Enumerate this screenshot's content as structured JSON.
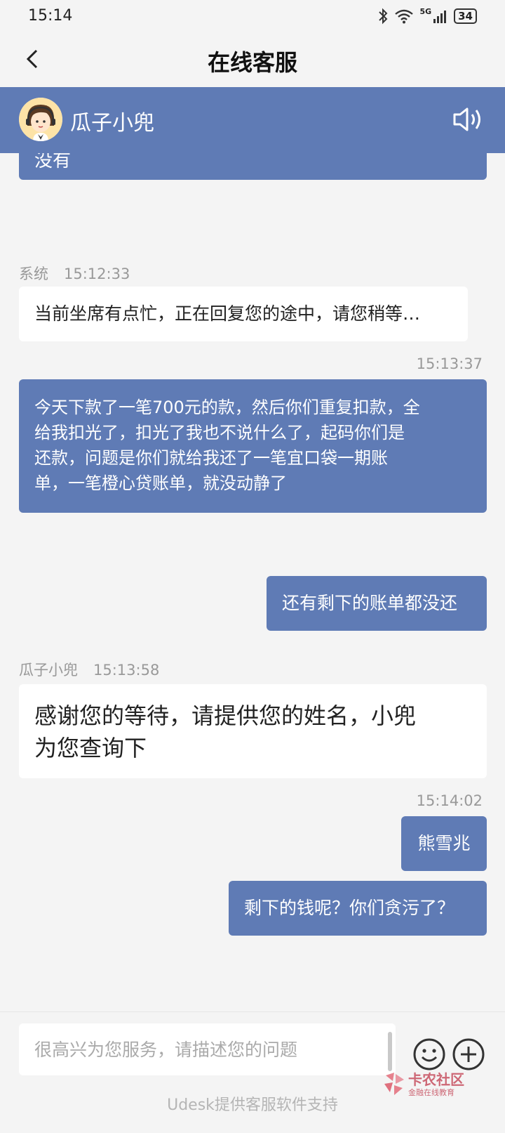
{
  "status_bar": {
    "time": "15:14",
    "network": "5G",
    "battery": "34"
  },
  "nav": {
    "title": "在线客服"
  },
  "agent": {
    "name": "瓜子小兜"
  },
  "messages": {
    "m0": {
      "text": "没有"
    },
    "m1": {
      "sender": "系统",
      "time": "15:12:33",
      "text": "当前坐席有点忙，正在回复您的途中，请您稍等…"
    },
    "m2": {
      "time": "15:13:37",
      "lines": [
        "今天下款了一笔700元的款，然后你们重复扣款，全",
        "给我扣光了，扣光了我也不说什么了，起码你们是",
        "还款，问题是你们就给我还了一笔宜口袋一期账",
        "单，一笔橙心贷账单，就没动静了"
      ]
    },
    "m3": {
      "text": "还有剩下的账单都没还"
    },
    "m4": {
      "sender": "瓜子小兜",
      "time": "15:13:58",
      "lines": [
        "感谢您的等待，请提供您的姓名，小兜",
        "为您查询下"
      ]
    },
    "m5": {
      "time": "15:14:02",
      "text": "熊雪兆"
    },
    "m6": {
      "text": "剩下的钱呢？你们贪污了？"
    }
  },
  "input": {
    "placeholder": "很高兴为您服务，请描述您的问题"
  },
  "footer": {
    "text": "Udesk提供客服软件支持"
  },
  "watermark": {
    "title": "卡农社区",
    "subtitle": "金融在线教育"
  },
  "colors": {
    "accent": "#5f7bb5",
    "background": "#f4f4f4",
    "bubble_agent": "#ffffff"
  }
}
